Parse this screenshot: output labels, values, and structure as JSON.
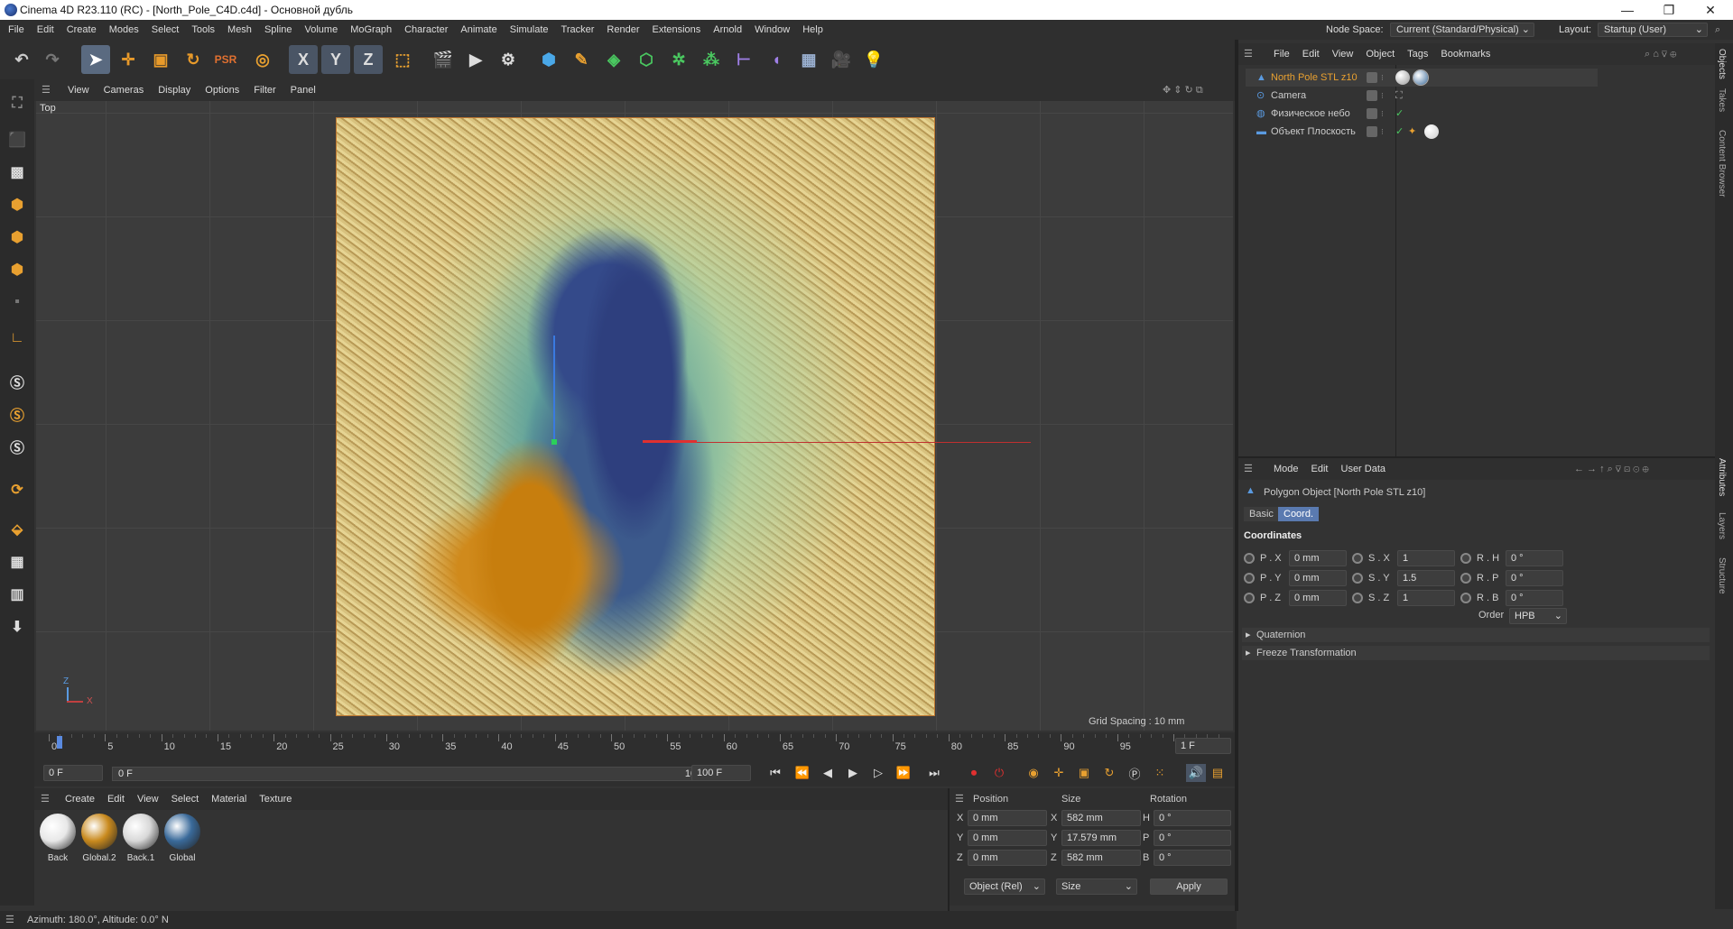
{
  "window": {
    "title": "Cinema 4D R23.110 (RC) - [North_Pole_C4D.c4d] - Основной дубль",
    "minimize": "—",
    "maximize": "❐",
    "close": "✕"
  },
  "menubar": {
    "items": [
      "File",
      "Edit",
      "Create",
      "Modes",
      "Select",
      "Tools",
      "Mesh",
      "Spline",
      "Volume",
      "MoGraph",
      "Character",
      "Animate",
      "Simulate",
      "Tracker",
      "Render",
      "Extensions",
      "Arnold",
      "Window",
      "Help"
    ],
    "node_space_label": "Node Space:",
    "node_space_value": "Current (Standard/Physical)",
    "layout_label": "Layout:",
    "layout_value": "Startup (User)"
  },
  "toolbar": {
    "axis_x": "X",
    "axis_y": "Y",
    "axis_z": "Z"
  },
  "viewport": {
    "menu": [
      "View",
      "Cameras",
      "Display",
      "Options",
      "Filter",
      "Panel"
    ],
    "name": "Top",
    "grid_spacing": "Grid Spacing : 10 mm",
    "axis_z": "Z",
    "axis_x": "X"
  },
  "timeline": {
    "ticks": [
      "0",
      "5",
      "10",
      "15",
      "20",
      "25",
      "30",
      "35",
      "40",
      "45",
      "50",
      "55",
      "60",
      "65",
      "70",
      "75",
      "80",
      "85",
      "90",
      "95",
      "100"
    ],
    "current_frame": "1 F",
    "start_field": "0 F",
    "range_start": "0 F",
    "range_end": "100 F",
    "end_field": "100 F"
  },
  "materials": {
    "menu": [
      "Create",
      "Edit",
      "View",
      "Select",
      "Material",
      "Texture"
    ],
    "items": [
      {
        "name": "Back",
        "color": "#e8e8e8"
      },
      {
        "name": "Global.2",
        "color": "#c98a1e"
      },
      {
        "name": "Back.1",
        "color": "#d8d8d8"
      },
      {
        "name": "Global",
        "color": "#3a6a9a"
      }
    ]
  },
  "coords": {
    "headers": [
      "Position",
      "Size",
      "Rotation"
    ],
    "rows": [
      {
        "axis": "X",
        "pos": "0 mm",
        "size_axis": "X",
        "size": "582 mm",
        "rot_axis": "H",
        "rot": "0 °"
      },
      {
        "axis": "Y",
        "pos": "0 mm",
        "size_axis": "Y",
        "size": "17.579 mm",
        "rot_axis": "P",
        "rot": "0 °"
      },
      {
        "axis": "Z",
        "pos": "0 mm",
        "size_axis": "Z",
        "size": "582 mm",
        "rot_axis": "B",
        "rot": "0 °"
      }
    ],
    "mode": "Object (Rel)",
    "size_mode": "Size",
    "apply": "Apply"
  },
  "status": {
    "text": "Azimuth: 180.0°, Altitude: 0.0°  N"
  },
  "objects": {
    "menu": [
      "File",
      "Edit",
      "View",
      "Object",
      "Tags",
      "Bookmarks"
    ],
    "items": [
      {
        "name": "North Pole STL z10",
        "selected": true
      },
      {
        "name": "Camera",
        "selected": false
      },
      {
        "name": "Физическое небо",
        "selected": false
      },
      {
        "name": "Объект Плоскость",
        "selected": false
      }
    ]
  },
  "attributes": {
    "menu": [
      "Mode",
      "Edit",
      "User Data"
    ],
    "object_title": "Polygon Object [North Pole STL z10]",
    "tabs": [
      "Basic",
      "Coord."
    ],
    "section": "Coordinates",
    "rows": [
      {
        "p": "P . X",
        "pv": "0 mm",
        "s": "S . X",
        "sv": "1",
        "r": "R . H",
        "rv": "0 °"
      },
      {
        "p": "P . Y",
        "pv": "0 mm",
        "s": "S . Y",
        "sv": "1.5",
        "r": "R . P",
        "rv": "0 °"
      },
      {
        "p": "P . Z",
        "pv": "0 mm",
        "s": "S . Z",
        "sv": "1",
        "r": "R . B",
        "rv": "0 °"
      }
    ],
    "order_label": "Order",
    "order_value": "HPB",
    "quaternion": "Quaternion",
    "freeze": "Freeze Transformation"
  },
  "right_tabs": [
    "Objects",
    "Takes",
    "Content Browser",
    "Attributes",
    "Layers",
    "Structure"
  ]
}
